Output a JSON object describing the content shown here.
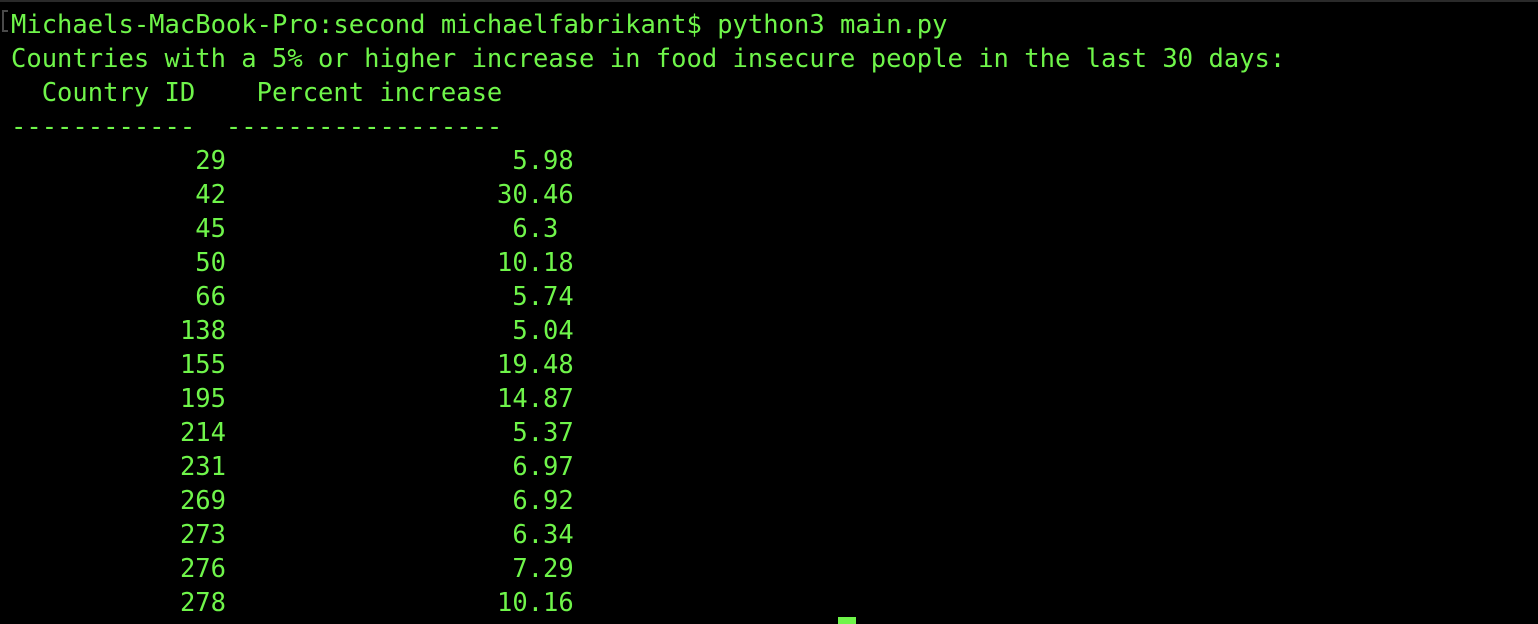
{
  "terminal": {
    "prompt": "Michaels-MacBook-Pro:second michaelfabrikant$ python3 main.py",
    "heading": "Countries with a 5% or higher increase in food insecure people in the last 30 days:",
    "table": {
      "header_line": "  Country ID    Percent increase",
      "separator_line": "------------  ------------------",
      "columns": [
        "Country ID",
        "Percent increase"
      ],
      "rows": [
        {
          "country_id": "29",
          "percent_increase": "5.98"
        },
        {
          "country_id": "42",
          "percent_increase": "30.46"
        },
        {
          "country_id": "45",
          "percent_increase": "6.3"
        },
        {
          "country_id": "50",
          "percent_increase": "10.18"
        },
        {
          "country_id": "66",
          "percent_increase": "5.74"
        },
        {
          "country_id": "138",
          "percent_increase": "5.04"
        },
        {
          "country_id": "155",
          "percent_increase": "19.48"
        },
        {
          "country_id": "195",
          "percent_increase": "14.87"
        },
        {
          "country_id": "214",
          "percent_increase": "5.37"
        },
        {
          "country_id": "231",
          "percent_increase": "6.97"
        },
        {
          "country_id": "269",
          "percent_increase": "6.92"
        },
        {
          "country_id": "273",
          "percent_increase": "6.34"
        },
        {
          "country_id": "276",
          "percent_increase": "7.29"
        },
        {
          "country_id": "278",
          "percent_increase": "10.16"
        }
      ]
    },
    "colors": {
      "foreground": "#6ff54a",
      "background": "#000000"
    }
  }
}
